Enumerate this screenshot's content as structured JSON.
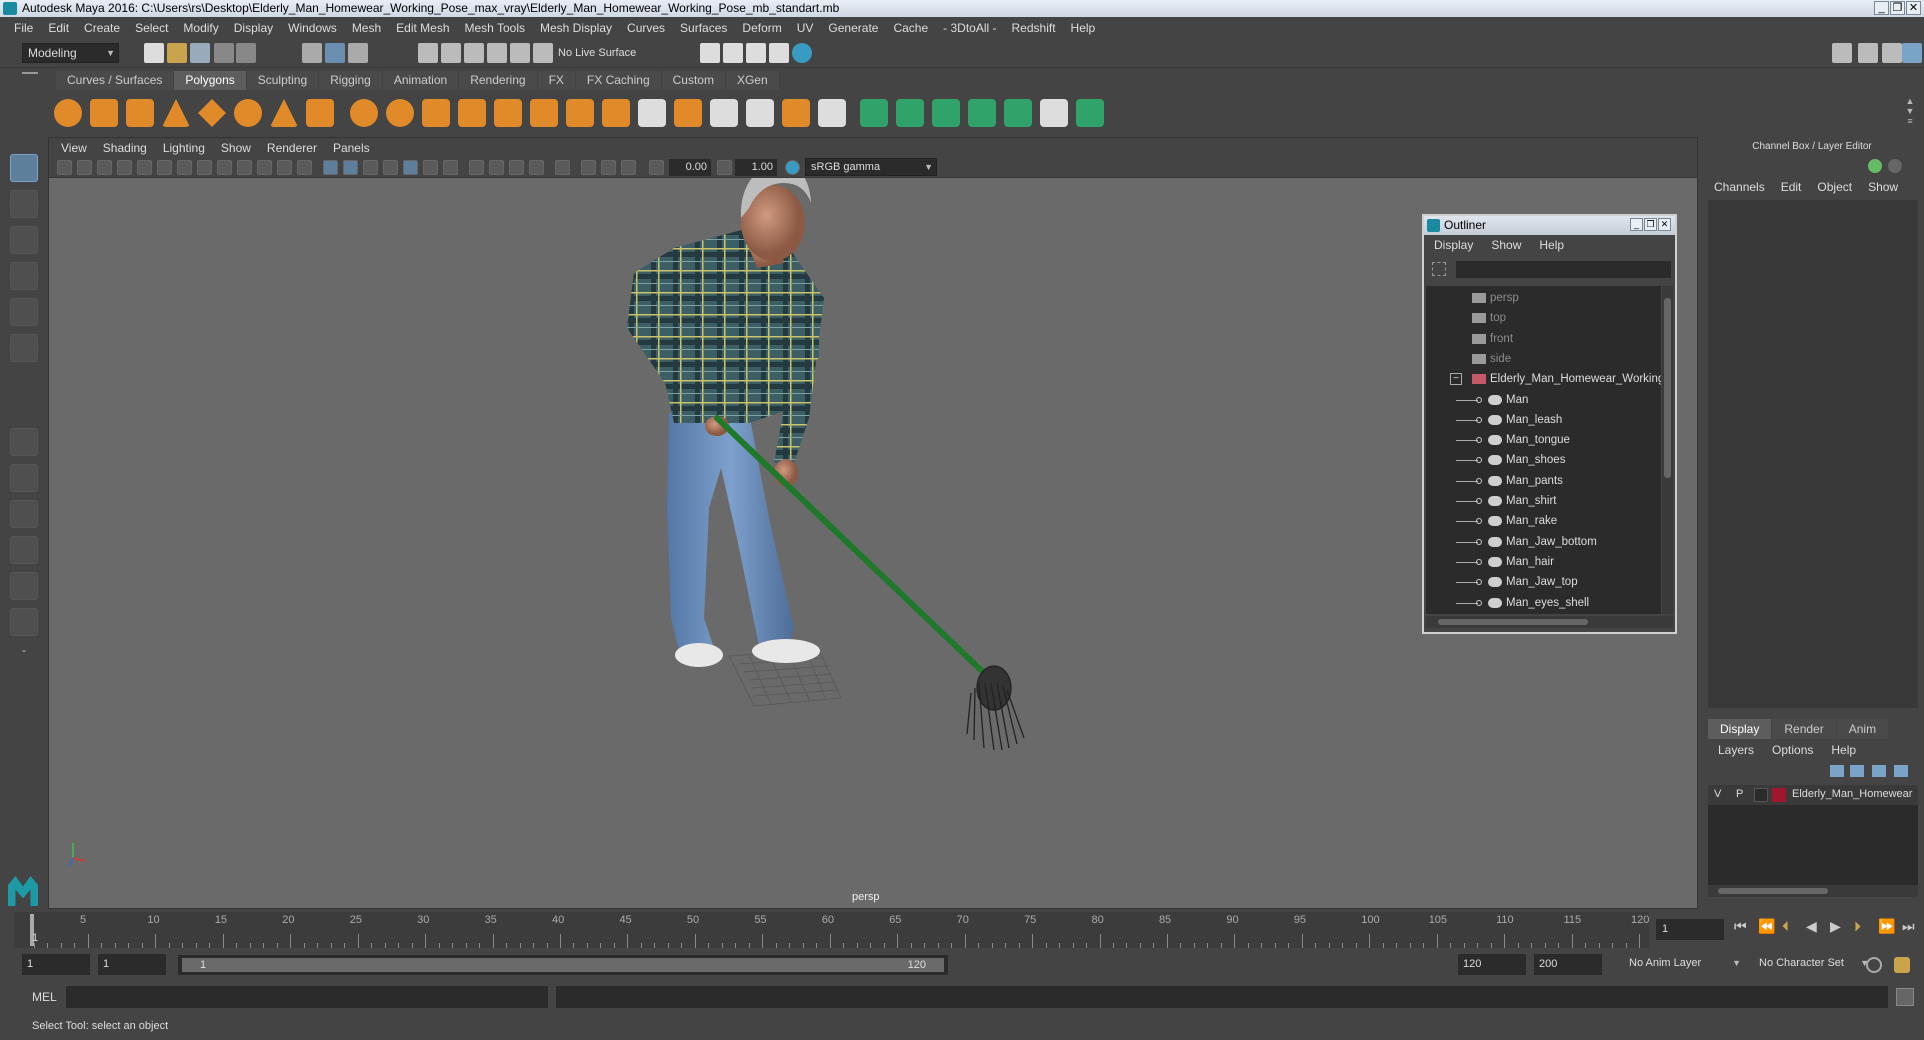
{
  "window": {
    "title": "Autodesk Maya 2016: C:\\Users\\rs\\Desktop\\Elderly_Man_Homewear_Working_Pose_max_vray\\Elderly_Man_Homewear_Working_Pose_mb_standart.mb",
    "controls": {
      "minimize": "_",
      "restore": "❐",
      "close": "✕"
    }
  },
  "menubar": {
    "items": [
      "File",
      "Edit",
      "Create",
      "Select",
      "Modify",
      "Display",
      "Windows",
      "Mesh",
      "Edit Mesh",
      "Mesh Tools",
      "Mesh Display",
      "Curves",
      "Surfaces",
      "Deform",
      "UV",
      "Generate",
      "Cache",
      "- 3DtoAll -",
      "Redshift",
      "Help"
    ]
  },
  "statusline": {
    "mode": "Modeling",
    "live_surface": "No Live Surface"
  },
  "shelf": {
    "tabs": [
      "Curves / Surfaces",
      "Polygons",
      "Sculpting",
      "Rigging",
      "Animation",
      "Rendering",
      "FX",
      "FX Caching",
      "Custom",
      "XGen"
    ],
    "active_tab": "Polygons"
  },
  "viewport": {
    "menu": [
      "View",
      "Shading",
      "Lighting",
      "Show",
      "Renderer",
      "Panels"
    ],
    "exposure": "0.00",
    "gamma": "1.00",
    "color_space": "sRGB gamma",
    "camera_label": "persp"
  },
  "outliner": {
    "title": "Outliner",
    "menu": [
      "Display",
      "Show",
      "Help"
    ],
    "cameras": [
      "persp",
      "top",
      "front",
      "side"
    ],
    "root": "Elderly_Man_Homewear_Working",
    "children": [
      "Man",
      "Man_leash",
      "Man_tongue",
      "Man_shoes",
      "Man_pants",
      "Man_shirt",
      "Man_rake",
      "Man_Jaw_bottom",
      "Man_hair",
      "Man_Jaw_top",
      "Man_eyes_shell"
    ]
  },
  "channelbox": {
    "title": "Channel Box / Layer Editor",
    "menu": [
      "Channels",
      "Edit",
      "Object",
      "Show"
    ],
    "layer_tabs": [
      "Display",
      "Render",
      "Anim"
    ],
    "active_layer_tab": "Display",
    "layer_menu": [
      "Layers",
      "Options",
      "Help"
    ],
    "layer": {
      "v": "V",
      "p": "P",
      "name": "Elderly_Man_Homewear",
      "color": "#a0162c"
    }
  },
  "timeline": {
    "labels": [
      "5",
      "10",
      "15",
      "20",
      "25",
      "30",
      "35",
      "40",
      "45",
      "50",
      "55",
      "60",
      "65",
      "70",
      "75",
      "80",
      "85",
      "90",
      "95",
      "100",
      "105",
      "110",
      "115",
      "120"
    ],
    "first_frame": "1",
    "current_frame": "1"
  },
  "range": {
    "start": "1",
    "playback_start": "1",
    "slider_start": "1",
    "slider_end": "120",
    "playback_end": "120",
    "end": "200",
    "anim_layer": "No Anim Layer",
    "character_set": "No Character Set"
  },
  "cmdline": {
    "label": "MEL"
  },
  "helpline": {
    "text": "Select Tool: select an object"
  },
  "colors": {
    "accent": "#5e7f9c",
    "rake": "#1e7a2a",
    "shirt": "#3d6a6e",
    "pants": "#5b7fae"
  }
}
